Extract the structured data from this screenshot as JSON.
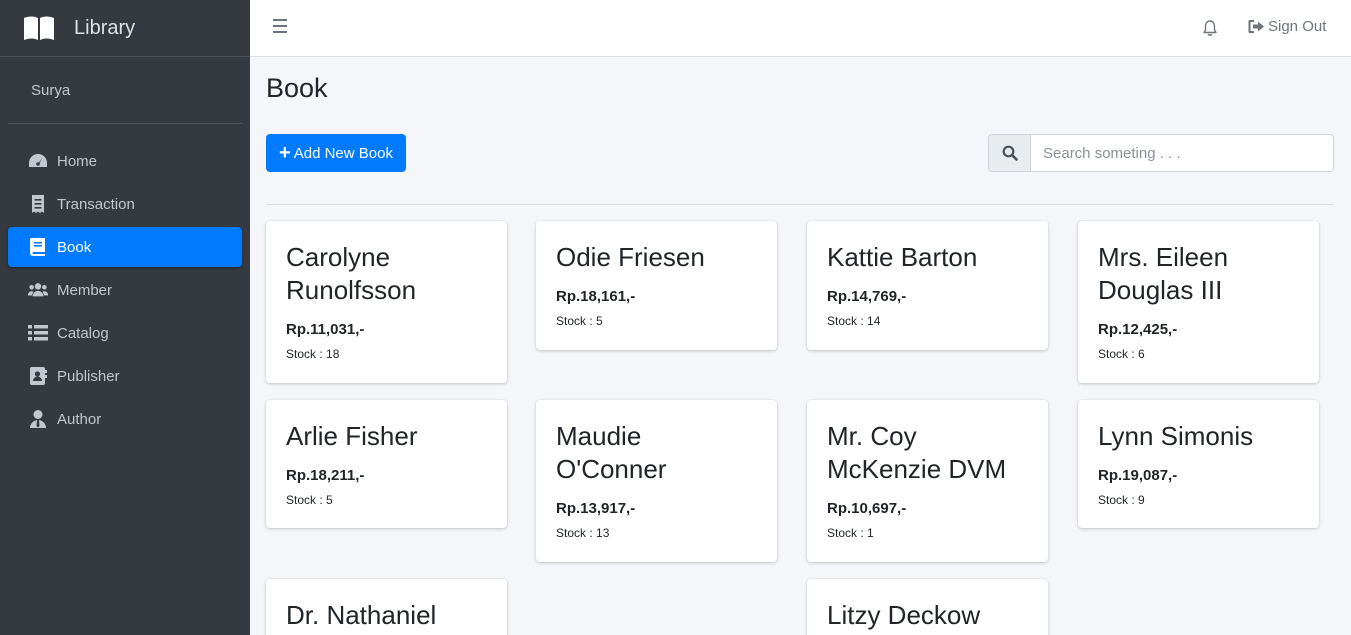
{
  "brand": {
    "title": "Library"
  },
  "user": {
    "name": "Surya"
  },
  "sidebar": {
    "items": [
      {
        "label": "Home",
        "icon": "tachometer-icon"
      },
      {
        "label": "Transaction",
        "icon": "receipt-icon"
      },
      {
        "label": "Book",
        "icon": "book-icon",
        "active": true
      },
      {
        "label": "Member",
        "icon": "users-icon"
      },
      {
        "label": "Catalog",
        "icon": "list-icon"
      },
      {
        "label": "Publisher",
        "icon": "address-book-icon"
      },
      {
        "label": "Author",
        "icon": "user-tie-icon"
      }
    ]
  },
  "navbar": {
    "signout_label": "Sign Out"
  },
  "page": {
    "title": "Book",
    "add_button_label": "Add New Book",
    "search_placeholder": "Search someting . . ."
  },
  "colors": {
    "sidebar_bg": "#343a40",
    "accent": "#007bff",
    "content_bg": "#f4f6f9"
  },
  "books": [
    {
      "title": "Carolyne Runolfsson",
      "price": "Rp.11,031,-",
      "stock": "Stock : 18"
    },
    {
      "title": "Odie Friesen",
      "price": "Rp.18,161,-",
      "stock": "Stock : 5"
    },
    {
      "title": "Kattie Barton",
      "price": "Rp.14,769,-",
      "stock": "Stock : 14"
    },
    {
      "title": "Mrs. Eileen Douglas III",
      "price": "Rp.12,425,-",
      "stock": "Stock : 6"
    },
    {
      "title": "Arlie Fisher",
      "price": "Rp.18,211,-",
      "stock": "Stock : 5"
    },
    {
      "title": "Maudie O'Conner",
      "price": "Rp.13,917,-",
      "stock": "Stock : 13"
    },
    {
      "title": "Mr. Coy McKenzie DVM",
      "price": "Rp.10,697,-",
      "stock": "Stock : 1"
    },
    {
      "title": "Lynn Simonis",
      "price": "Rp.19,087,-",
      "stock": "Stock : 9"
    },
    {
      "title": "Dr. Nathaniel",
      "price": "",
      "stock": ""
    },
    {
      "title": "Litzy Deckow",
      "price": "",
      "stock": ""
    }
  ]
}
